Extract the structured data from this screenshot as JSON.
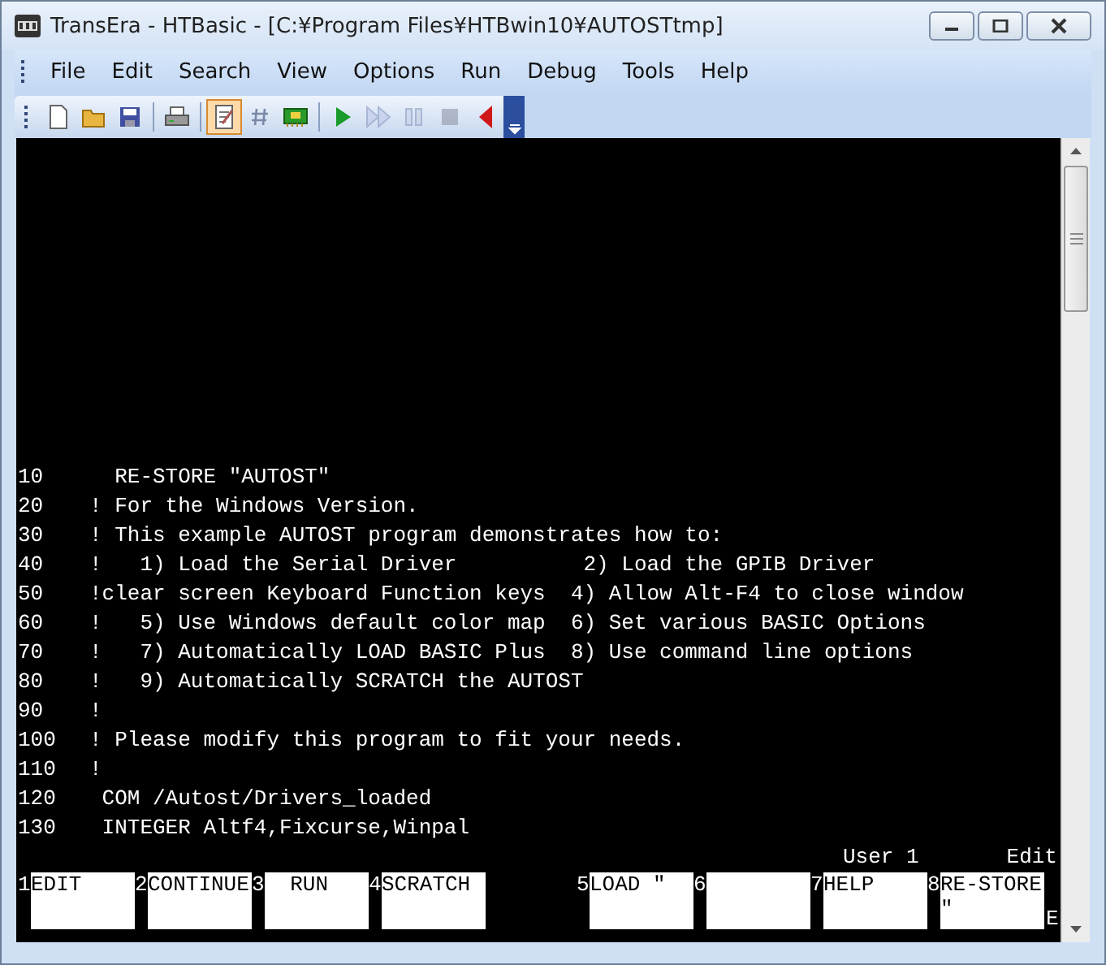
{
  "window": {
    "title": "TransEra - HTBasic - [C:¥Program Files¥HTBwin10¥AUTOSTtmp]"
  },
  "menu": [
    "File",
    "Edit",
    "Search",
    "View",
    "Options",
    "Run",
    "Debug",
    "Tools",
    "Help"
  ],
  "toolbar": [
    {
      "selected": false,
      "disabled": false
    },
    {
      "selected": false,
      "disabled": false
    },
    {
      "selected": false,
      "disabled": false
    },
    {
      "selected": false,
      "disabled": false
    },
    {
      "selected": true,
      "disabled": false
    },
    {
      "selected": false,
      "disabled": false
    },
    {
      "selected": false,
      "disabled": false
    },
    {
      "selected": false,
      "disabled": false
    },
    {
      "selected": false,
      "disabled": true
    },
    {
      "selected": false,
      "disabled": true
    },
    {
      "selected": false,
      "disabled": true
    },
    {
      "selected": false,
      "disabled": false
    }
  ],
  "lines": [
    {
      "number": "10",
      "text": "  RE-STORE \"AUTOST\""
    },
    {
      "number": "20",
      "text": "! For the Windows Version."
    },
    {
      "number": "30",
      "text": "! This example AUTOST program demonstrates how to:"
    },
    {
      "number": "40",
      "text": "!   1) Load the Serial Driver          2) Load the GPIB Driver"
    },
    {
      "number": "50",
      "text": "!clear screen Keyboard Function keys  4) Allow Alt-F4 to close window"
    },
    {
      "number": "60",
      "text": "!   5) Use Windows default color map  6) Set various BASIC Options"
    },
    {
      "number": "70",
      "text": "!   7) Automatically LOAD BASIC Plus  8) Use command line options"
    },
    {
      "number": "80",
      "text": "!   9) Automatically SCRATCH the AUTOST"
    },
    {
      "number": "90",
      "text": "!"
    },
    {
      "number": "100",
      "text": "! Please modify this program to fit your needs."
    },
    {
      "number": "110",
      "text": "!"
    },
    {
      "number": "120",
      "text": " COM /Autost/Drivers_loaded"
    },
    {
      "number": "130",
      "text": " INTEGER Altf4,Fixcurse,Winpal"
    }
  ],
  "status": {
    "left": "User 1",
    "right": "Edit"
  },
  "softkeys": [
    {
      "number": "1",
      "label": [
        "EDIT"
      ]
    },
    {
      "number": "2",
      "label": [
        "CONTINUE"
      ]
    },
    {
      "number": "3",
      "label": [
        "  RUN"
      ]
    },
    {
      "number": "4",
      "label": [
        "SCRATCH"
      ]
    },
    {
      "number": "5",
      "label": [
        "LOAD \""
      ]
    },
    {
      "number": "6"
    },
    {
      "number": "7",
      "label": [
        "HELP"
      ]
    },
    {
      "number": "8",
      "label": [
        "RE-STORE",
        "\""
      ]
    }
  ],
  "cursor_mark": "E"
}
